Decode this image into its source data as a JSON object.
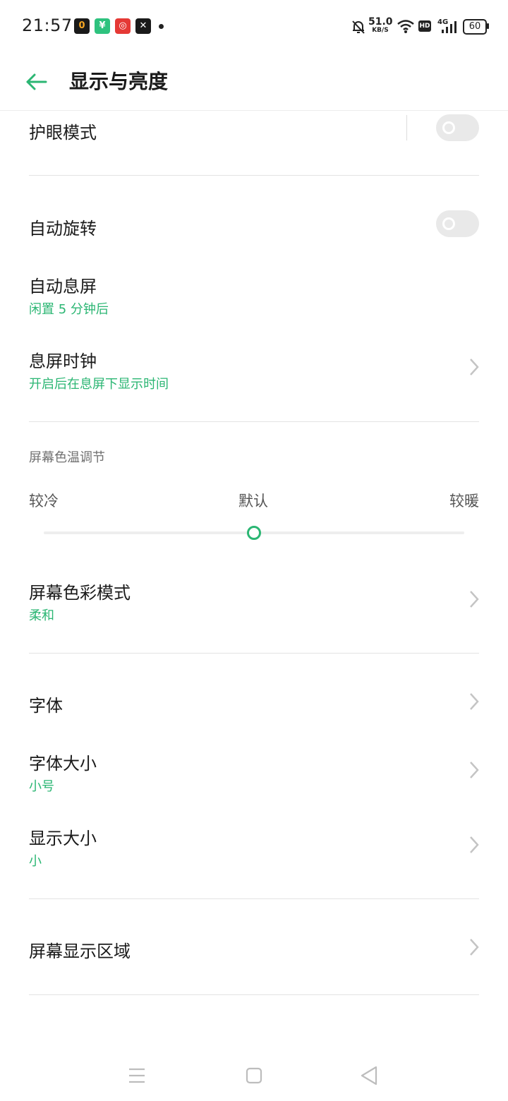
{
  "status_bar": {
    "time": "21:57",
    "net_speed_value": "51.0",
    "net_speed_unit": "KB/S",
    "hd_label": "HD",
    "network_type": "4G",
    "battery_level": "60"
  },
  "header": {
    "title": "显示与亮度"
  },
  "settings": {
    "eye_mode": {
      "label": "护眼模式",
      "enabled": false
    },
    "auto_rotate": {
      "label": "自动旋转",
      "enabled": false
    },
    "screen_timeout": {
      "label": "自动息屏",
      "value": "闲置 5 分钟后"
    },
    "aod_clock": {
      "label": "息屏时钟",
      "value": "开启后在息屏下显示时间"
    },
    "color_temp": {
      "section_label": "屏幕色温调节",
      "cool_label": "较冷",
      "default_label": "默认",
      "warm_label": "较暖",
      "level": 0.5
    },
    "color_mode": {
      "label": "屏幕色彩模式",
      "value": "柔和"
    },
    "font": {
      "label": "字体"
    },
    "font_size": {
      "label": "字体大小",
      "value": "小号"
    },
    "display_size": {
      "label": "显示大小",
      "value": "小"
    },
    "display_area": {
      "label": "屏幕显示区域"
    }
  },
  "colors": {
    "accent": "#2bb673",
    "divider": "#e3e3e3"
  }
}
